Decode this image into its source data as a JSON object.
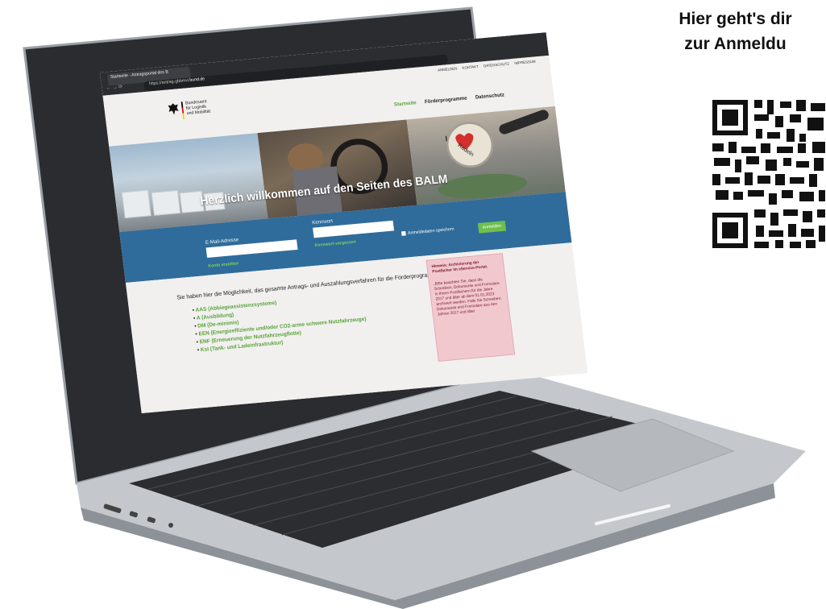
{
  "promo": {
    "line1": "Hier geht's dir",
    "line2": "zur Anmeldu",
    "qr_icon": "qr-code-icon"
  },
  "browser": {
    "tab_title": "Startseite - Antragsportal des B",
    "url_prefix": "https://antrag-gbbmvi.",
    "url_domain": "bund.de"
  },
  "site": {
    "top_links": [
      "ANMELDEN",
      "KONTAKT",
      "DATENSCHUTZ",
      "IMPRESSUM"
    ],
    "logo_lines": [
      "Bundesamt",
      "für Logistik",
      "und Mobilität"
    ],
    "nav": [
      {
        "label": "Startseite",
        "active": true
      },
      {
        "label": "Förderprogramme",
        "active": false
      },
      {
        "label": "Datenschutz",
        "active": false
      }
    ],
    "hero_title": "Herzlich willkommen auf den Seiten des BALM",
    "hero_badge_top": "I",
    "hero_badge_word": "Radeln",
    "login": {
      "email_label": "E-Mail-Adresse",
      "password_label": "Kennwort",
      "remember_label": "Anmeldedaten speichern",
      "login_button": "Anmelden",
      "forgot_link": "Kennwort vergessen",
      "create_link": "Konto erstellen"
    },
    "intro": "Sie haben hier die Möglichkeit, das gesamte Antrags- und Auszahlungsverfahren für die Förderprogramme",
    "programs": [
      "AAS (Abbiegeassistenzsysteme)",
      "A (Ausbildung)",
      "DM (De-minimis)",
      "EEN (Energieeffiziente und/oder CO2-arme schwere Nutzfahrzeuge)",
      "ENF (Erneuerung der Nutzfahrzeugflotte)",
      "KsI (Tank- und Ladeinfrastruktur)"
    ],
    "notice": {
      "title": "Hinweis: Archivierung der Postfächer im eService-Portal.",
      "body": "„Bitte beachten Sie, dass die Schreiben, Dokumente und Formulare in Ihrem Postfächern für die Jahre 2017 und älter ab dem 01.01.2023 archiviert werden. Falls Sie Schreiben, Dokumente und Formulare aus den Jahren 2017 und älter"
    }
  }
}
